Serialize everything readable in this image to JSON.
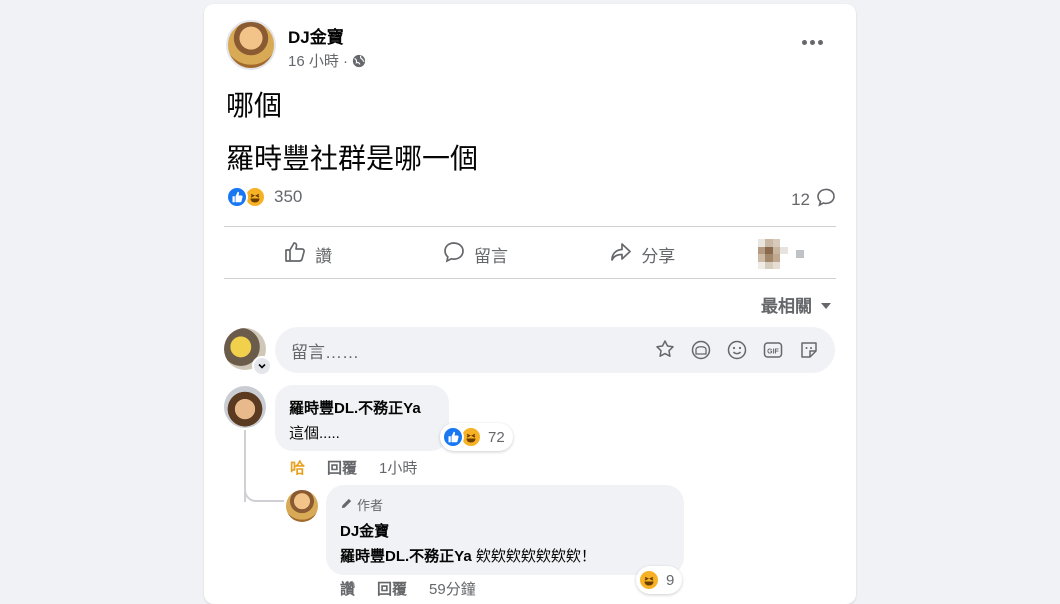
{
  "post": {
    "author": "DJ金寶",
    "time": "16 小時 ·",
    "privacy_icon": "globe-icon",
    "lines": [
      "哪個",
      "羅時豐社群是哪一個"
    ],
    "reaction_count": "350",
    "comment_count": "12"
  },
  "actions": {
    "like": "讚",
    "comment": "留言",
    "share": "分享"
  },
  "sort": {
    "label": "最相關"
  },
  "composer": {
    "placeholder": "留言……"
  },
  "comments": [
    {
      "name": "羅時豐DL.不務正Ya",
      "text": "這個.....",
      "reaction_count": "72",
      "action_react": "哈",
      "action_reply": "回覆",
      "time": "1小時"
    },
    {
      "badge": "作者",
      "name": "DJ金寶",
      "mention": "羅時豐DL.不務正Ya",
      "text": " 欸欸欸欸欸欸欸！",
      "reaction_count": "9",
      "action_react": "讚",
      "action_reply": "回覆",
      "time": "59分鐘"
    }
  ],
  "colors": {
    "like_blue": "#1877f2",
    "haha_yellow": "#f7b125",
    "secondary_text": "#65676b",
    "bubble_bg": "#f0f2f5"
  }
}
